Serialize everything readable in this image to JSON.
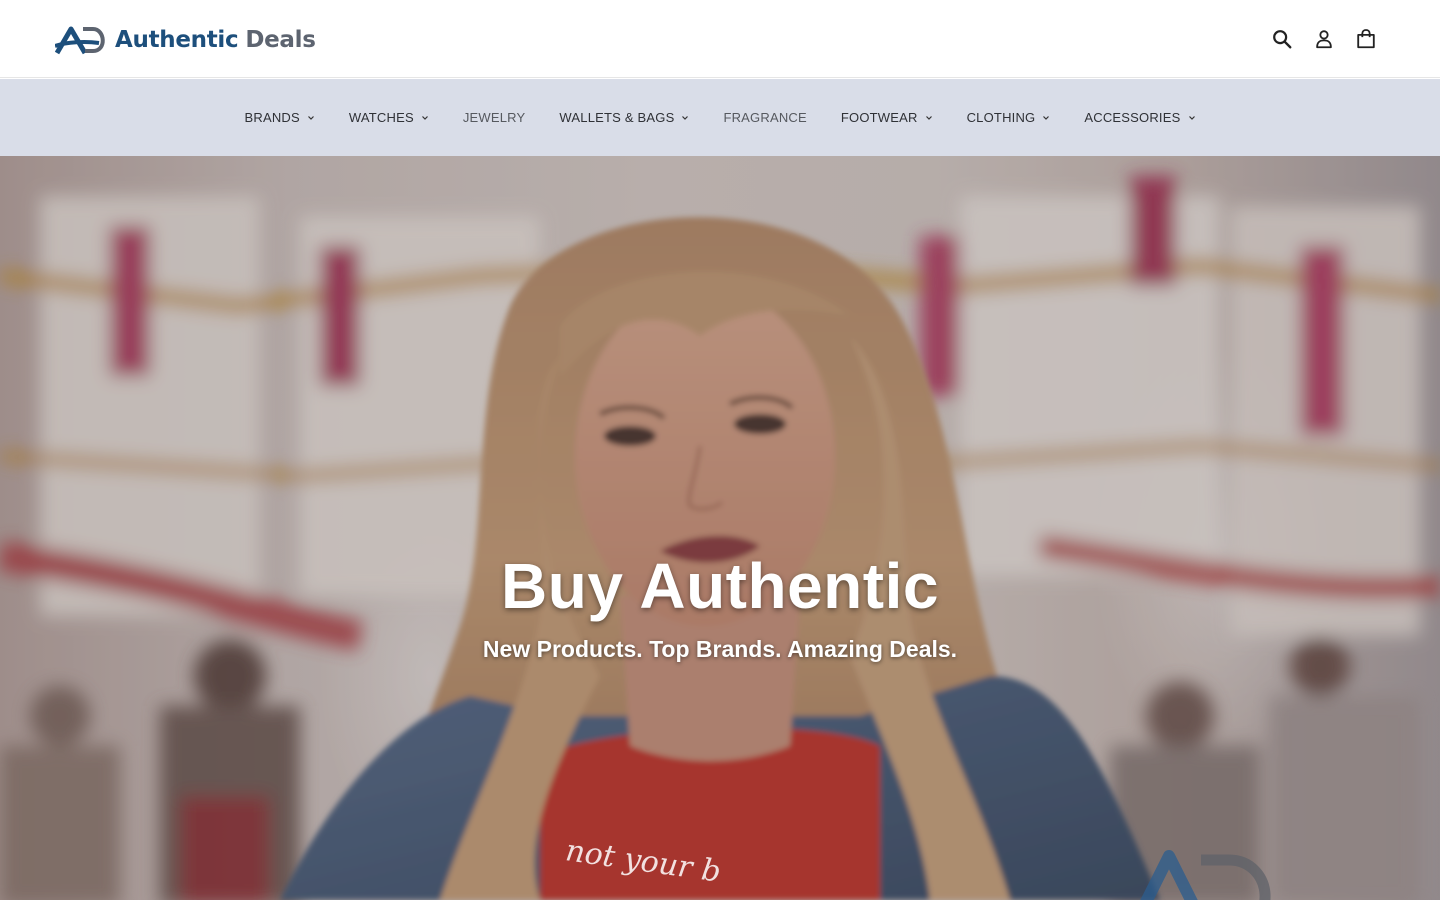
{
  "header": {
    "logo": {
      "mark": "AD",
      "word1": "Authentic",
      "word2": "Deals"
    },
    "icons": [
      "search-icon",
      "account-icon",
      "cart-icon"
    ]
  },
  "nav": {
    "items": [
      {
        "label": "BRANDS",
        "has_dropdown": true
      },
      {
        "label": "WATCHES",
        "has_dropdown": true
      },
      {
        "label": "JEWELRY",
        "has_dropdown": false
      },
      {
        "label": "WALLETS & BAGS",
        "has_dropdown": true
      },
      {
        "label": "FRAGRANCE",
        "has_dropdown": false
      },
      {
        "label": "FOOTWEAR",
        "has_dropdown": true
      },
      {
        "label": "CLOTHING",
        "has_dropdown": true
      },
      {
        "label": "ACCESSORIES",
        "has_dropdown": true
      }
    ]
  },
  "hero": {
    "title": "Buy Authentic",
    "subtitle": "New Products. Top Brands. Amazing Deals.",
    "shirt_text": "not your b"
  },
  "colors": {
    "brand_blue": "#1d4f7c",
    "brand_gray": "#5d6470",
    "nav_bg": "#d9dde8",
    "hero_text": "#ffffff"
  }
}
